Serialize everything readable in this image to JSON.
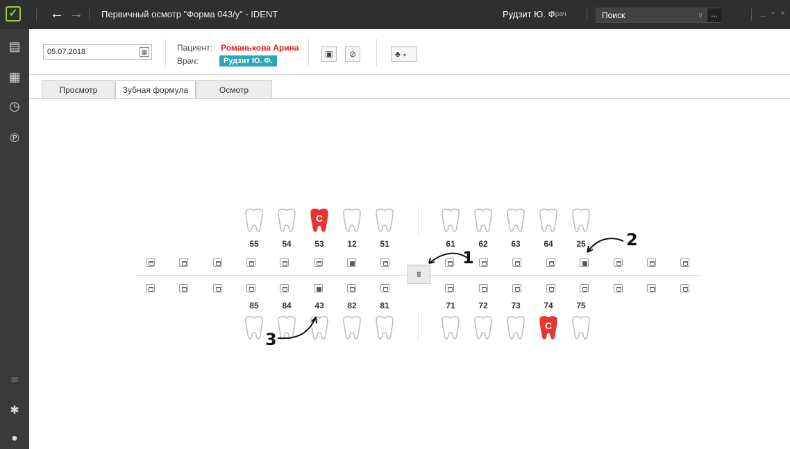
{
  "window": {
    "title": "Первичный осмотр \"Форма 043/у\" - IDENT",
    "user_name": "Рудзит Ю. Ф.",
    "user_role": "Врач",
    "search_placeholder": "Поиск",
    "search_more": "...",
    "controls": "_ ▫ ×"
  },
  "icons": {
    "logo": "checkbox-logo-icon",
    "back": "arrow-left-icon",
    "forward": "arrow-right-icon"
  },
  "sidebar": [
    "patient-card-icon",
    "calendar-icon",
    "history-clock-icon",
    "rules-icon",
    "mail-icon",
    "gear-icon",
    "user-icon"
  ],
  "toolbar": {
    "date": "05.07.2018",
    "patient_label": "Пациент:",
    "patient_name": "Романькова Арина",
    "doctor_label": "Врач:",
    "doctor_name": "Рудзит Ю. Ф."
  },
  "tabs": [
    "Просмотр",
    "Зубная формула",
    "Осмотр"
  ],
  "active_tab": "Зубная формула",
  "teeth": {
    "upper_left": [
      "55",
      "54",
      "53",
      "12",
      "51"
    ],
    "upper_right": [
      "61",
      "62",
      "63",
      "64",
      "25"
    ],
    "lower_left": [
      "85",
      "84",
      "43",
      "82",
      "81"
    ],
    "lower_right": [
      "71",
      "72",
      "73",
      "74",
      "75"
    ],
    "caries_label": "C",
    "caries_teeth": [
      "53",
      "74"
    ],
    "filled_indicators": [
      "12",
      "25",
      "43"
    ]
  },
  "annotations": [
    "1",
    "2",
    "3"
  ],
  "colors": {
    "caries": "#e8342e",
    "patient": "#e01b24",
    "doctor_badge": "#2aa7b8",
    "titlebar": "#2f2f2f",
    "sidebar": "#3a3a3a"
  }
}
